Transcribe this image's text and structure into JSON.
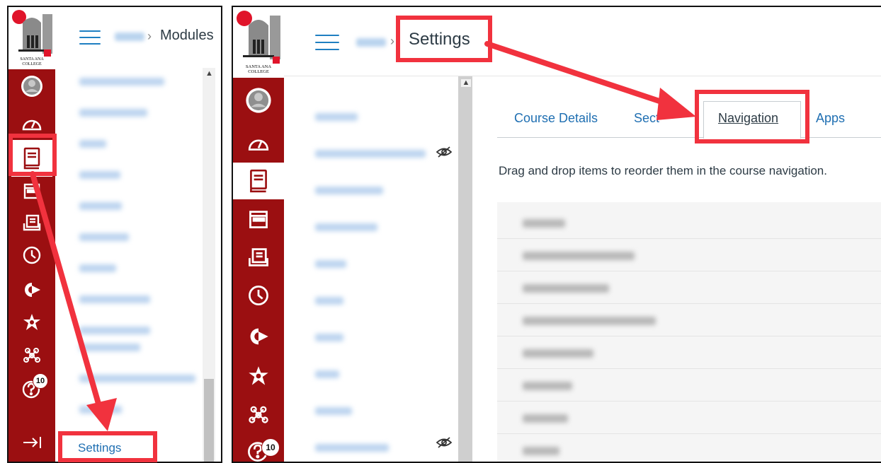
{
  "left_panel": {
    "logo_text_line1": "SANTA ANA",
    "logo_text_line2": "COLLEGE",
    "breadcrumb_current": "Modules",
    "settings_link": "Settings",
    "help_badge": "10",
    "global_nav_icons": [
      "account-icon",
      "dashboard-icon",
      "courses-icon",
      "calendar-icon",
      "inbox-icon",
      "history-icon",
      "commons-icon",
      "studio-icon",
      "network-icon",
      "help-icon"
    ],
    "collapse_icon": "collapse-nav-icon"
  },
  "right_panel": {
    "logo_text_line1": "SANTA ANA",
    "logo_text_line2": "COLLEGE",
    "breadcrumb_current": "Settings",
    "help_badge": "10",
    "tabs": [
      {
        "label": "Course Details"
      },
      {
        "label": "Sect"
      },
      {
        "label": "Navigation"
      },
      {
        "label": "Apps"
      }
    ],
    "instructions": "Drag and drop items to reorder them in the course navigation."
  },
  "colors": {
    "brand_red": "#9b0f11",
    "annotation_red": "#f1323e",
    "link_blue": "#1f6fb2"
  }
}
